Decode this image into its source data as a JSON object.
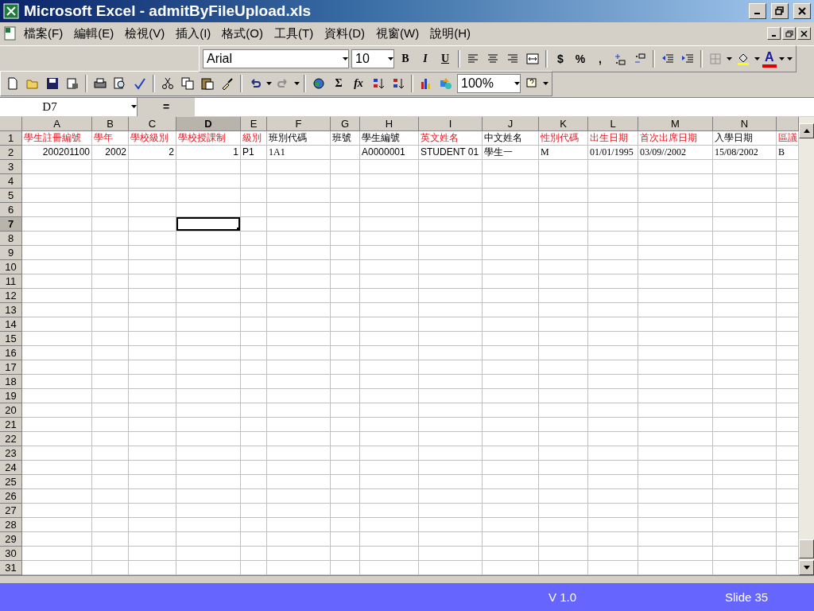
{
  "window": {
    "title": "Microsoft Excel - admitByFileUpload.xls"
  },
  "menu": {
    "items": [
      "檔案(F)",
      "編輯(E)",
      "檢視(V)",
      "插入(I)",
      "格式(O)",
      "工具(T)",
      "資料(D)",
      "視窗(W)",
      "說明(H)"
    ]
  },
  "format_toolbar": {
    "font": "Arial",
    "size": "10",
    "style_buttons": [
      "B",
      "I",
      "U"
    ],
    "number_buttons": [
      "$",
      "%",
      ","
    ],
    "font_color_button": "A"
  },
  "standard_toolbar": {
    "function_buttons": [
      "Σ",
      "fx"
    ],
    "zoom": "100%"
  },
  "formula_bar": {
    "name_box": "D7",
    "equals": "="
  },
  "sheet": {
    "columns": [
      {
        "letter": "A",
        "selected": false
      },
      {
        "letter": "B",
        "selected": false
      },
      {
        "letter": "C",
        "selected": false
      },
      {
        "letter": "D",
        "selected": true
      },
      {
        "letter": "E",
        "selected": false
      },
      {
        "letter": "F",
        "selected": false
      },
      {
        "letter": "G",
        "selected": false
      },
      {
        "letter": "H",
        "selected": false
      },
      {
        "letter": "I",
        "selected": false
      },
      {
        "letter": "J",
        "selected": false
      },
      {
        "letter": "K",
        "selected": false
      },
      {
        "letter": "L",
        "selected": false
      },
      {
        "letter": "M",
        "selected": false
      },
      {
        "letter": "N",
        "selected": false
      }
    ],
    "rows": [
      {
        "number": "1",
        "selected": false,
        "cells": [
          {
            "kind": "text",
            "text": "學生註冊編號",
            "required": true
          },
          {
            "kind": "text",
            "text": "學年",
            "required": true
          },
          {
            "kind": "text",
            "text": "學校級別",
            "required": true
          },
          {
            "kind": "text",
            "text": "學校授課制",
            "required": true
          },
          {
            "kind": "text",
            "text": "級別",
            "required": true
          },
          {
            "kind": "text",
            "text": "班別代碼",
            "required": false
          },
          {
            "kind": "text",
            "text": "班號",
            "required": false
          },
          {
            "kind": "text",
            "text": "學生編號",
            "required": false
          },
          {
            "kind": "text",
            "text": "英文姓名",
            "required": true
          },
          {
            "kind": "text",
            "text": "中文姓名",
            "required": false
          },
          {
            "kind": "text",
            "text": "性別代碼",
            "required": true
          },
          {
            "kind": "text",
            "text": "出生日期",
            "required": true
          },
          {
            "kind": "text",
            "text": "首次出席日期",
            "required": true
          },
          {
            "kind": "text",
            "text": "入學日期",
            "required": false
          },
          {
            "kind": "text",
            "text": "區議",
            "required": true
          }
        ]
      },
      {
        "number": "2",
        "selected": false,
        "cells": [
          {
            "kind": "number",
            "text": "200201100"
          },
          {
            "kind": "number",
            "text": "2002"
          },
          {
            "kind": "number",
            "text": "2"
          },
          {
            "kind": "number",
            "text": "1"
          },
          {
            "kind": "text",
            "text": "P1"
          },
          {
            "kind": "serif",
            "text": "1A1"
          },
          {
            "kind": "empty"
          },
          {
            "kind": "text",
            "text": "A0000001"
          },
          {
            "kind": "text",
            "text": "STUDENT 01"
          },
          {
            "kind": "text",
            "text": "學生一"
          },
          {
            "kind": "serif",
            "text": "M"
          },
          {
            "kind": "serif",
            "text": "01/01/1995"
          },
          {
            "kind": "serif",
            "text": "03/09//2002"
          },
          {
            "kind": "serif",
            "text": "15/08/2002"
          },
          {
            "kind": "serif",
            "text": "B"
          }
        ]
      },
      {
        "number": "3",
        "selected": false
      },
      {
        "number": "4",
        "selected": false
      },
      {
        "number": "5",
        "selected": false
      },
      {
        "number": "6",
        "selected": false
      },
      {
        "number": "7",
        "selected": true
      },
      {
        "number": "8",
        "selected": false
      },
      {
        "number": "9",
        "selected": false
      },
      {
        "number": "10",
        "selected": false
      },
      {
        "number": "11",
        "selected": false
      },
      {
        "number": "12",
        "selected": false
      },
      {
        "number": "13",
        "selected": false
      },
      {
        "number": "14",
        "selected": false
      },
      {
        "number": "15",
        "selected": false
      },
      {
        "number": "16",
        "selected": false
      },
      {
        "number": "17",
        "selected": false
      },
      {
        "number": "18",
        "selected": false
      },
      {
        "number": "19",
        "selected": false
      },
      {
        "number": "20",
        "selected": false
      },
      {
        "number": "21",
        "selected": false
      },
      {
        "number": "22",
        "selected": false
      },
      {
        "number": "23",
        "selected": false
      },
      {
        "number": "24",
        "selected": false
      },
      {
        "number": "25",
        "selected": false
      },
      {
        "number": "26",
        "selected": false
      },
      {
        "number": "27",
        "selected": false
      },
      {
        "number": "28",
        "selected": false
      },
      {
        "number": "29",
        "selected": false
      },
      {
        "number": "30",
        "selected": false
      },
      {
        "number": "31",
        "selected": false
      }
    ]
  },
  "footer": {
    "version": "V 1.0",
    "slide": "Slide 35"
  }
}
